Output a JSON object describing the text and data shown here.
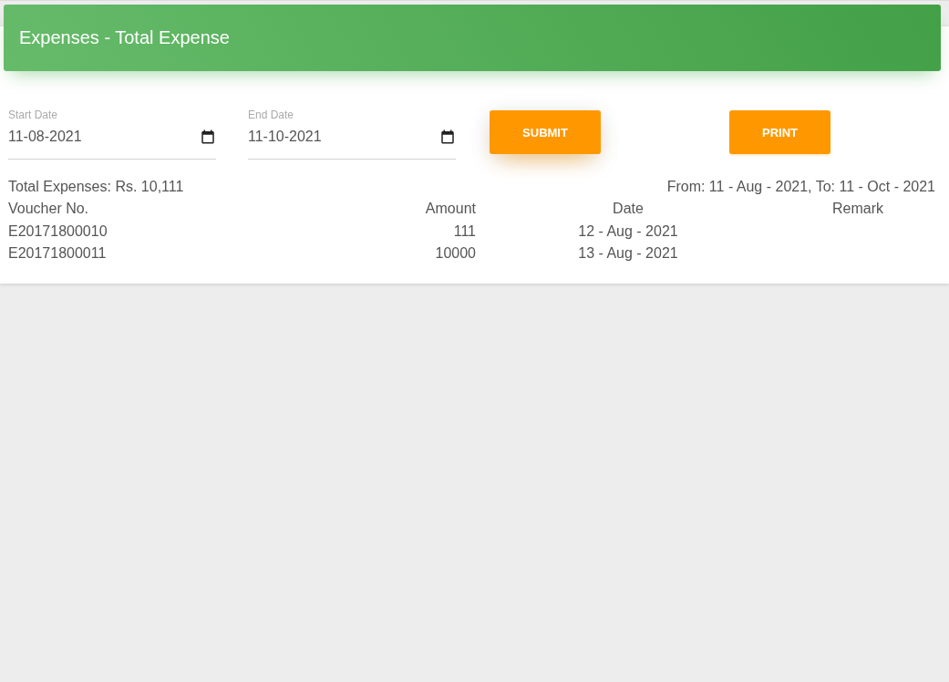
{
  "header": {
    "title": "Expenses - Total Expense"
  },
  "fields": [
    {
      "label": "Start Date",
      "value": "11-08-2021"
    },
    {
      "label": "End Date",
      "value": "11-10-2021"
    }
  ],
  "buttons": [
    "SUBMIT",
    "PRINT"
  ],
  "summary": {
    "total": "Total Expenses: Rs. 10,111",
    "range": "From: 11 - Aug - 2021, To: 11 - Oct - 2021"
  },
  "table": {
    "columns": [
      "Voucher No.",
      "Amount",
      "Date",
      "Remark"
    ],
    "rows": [
      [
        "E20171800010",
        "111",
        "12 - Aug - 2021"
      ],
      [
        "E20171800011",
        "10000",
        "13 - Aug - 2021"
      ]
    ]
  }
}
